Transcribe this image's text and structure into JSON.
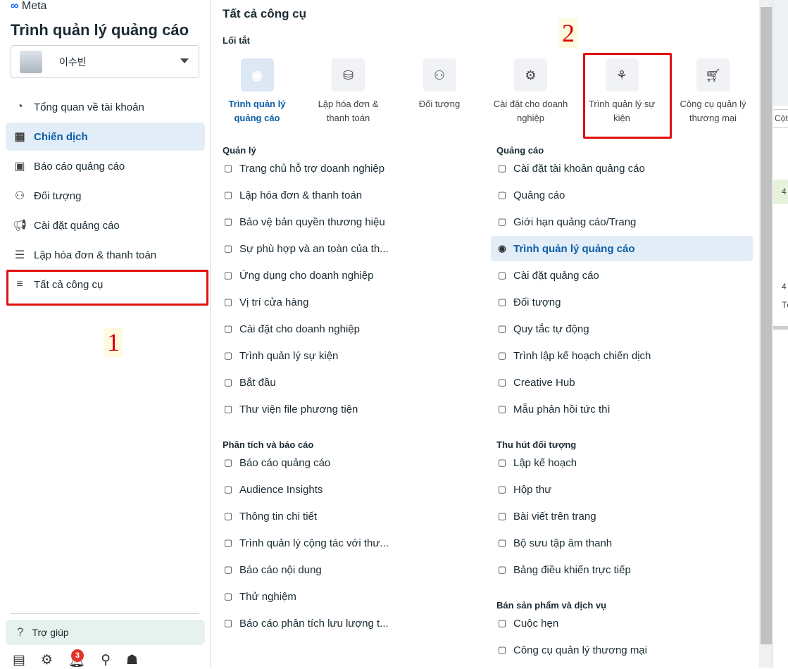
{
  "sidebar": {
    "brand": "Meta",
    "title": "Trình quản lý quảng cáo",
    "account": "이수빈",
    "items": [
      {
        "label": "Tổng quan về tài khoản",
        "icon": "gauge-icon"
      },
      {
        "label": "Chiến dịch",
        "icon": "table-icon",
        "active": true
      },
      {
        "label": "Báo cáo quảng cáo",
        "icon": "report-icon"
      },
      {
        "label": "Đối tượng",
        "icon": "people-icon"
      },
      {
        "label": "Cài đặt quảng cáo",
        "icon": "megaphone-icon"
      },
      {
        "label": "Lập hóa đơn & thanh toán",
        "icon": "billing-icon"
      },
      {
        "label": "Tất cả công cụ",
        "icon": "menu-icon"
      }
    ],
    "help": "Trợ giúp",
    "notification_count": "3"
  },
  "annotations": {
    "one": "1",
    "two": "2",
    "highlight_color": "#e01010"
  },
  "main": {
    "title": "Tất cả công cụ",
    "shortcuts_heading": "Lối tắt",
    "shortcuts": [
      {
        "label": "Trình quản lý quảng cáo",
        "active": true
      },
      {
        "label": "Lập hóa đơn & thanh toán"
      },
      {
        "label": "Đối tượng"
      },
      {
        "label": "Cài đặt cho doanh nghiệp"
      },
      {
        "label": "Trình quản lý sự kiện"
      },
      {
        "label": "Công cụ quản lý thương mại"
      }
    ],
    "manage": {
      "heading": "Quản lý",
      "items": [
        "Trang chủ hỗ trợ doanh nghiệp",
        "Lập hóa đơn & thanh toán",
        "Bảo vệ bản quyền thương hiệu",
        "Sự phù hợp và an toàn của th...",
        "Ứng dụng cho doanh nghiệp",
        "Vị trí cửa hàng",
        "Cài đặt cho doanh nghiệp",
        "Trình quản lý sự kiện",
        "Bắt đầu",
        "Thư viện file phương tiện"
      ]
    },
    "analytics": {
      "heading": "Phân tích và báo cáo",
      "items": [
        "Báo cáo quảng cáo",
        "Audience Insights",
        "Thông tin chi tiết",
        "Trình quản lý cộng tác với thư...",
        "Báo cáo nội dung",
        "Thử nghiệm",
        "Báo cáo phân tích lưu lượng t..."
      ]
    },
    "ads": {
      "heading": "Quảng cáo",
      "items": [
        "Cài đặt tài khoản quảng cáo",
        "Quảng cáo",
        "Giới hạn quảng cáo/Trang",
        "Trình quản lý quảng cáo",
        "Cài đặt quảng cáo",
        "Đối tượng",
        "Quy tắc tự động",
        "Trình lập kế hoạch chiến dịch",
        "Creative Hub",
        "Mẫu phản hồi tức thì"
      ]
    },
    "engage": {
      "heading": "Thu hút đối tượng",
      "items": [
        "Lập kế hoạch",
        "Hộp thư",
        "Bài viết trên trang",
        "Bộ sưu tập âm thanh",
        "Bảng điều khiển trực tiếp"
      ]
    },
    "sell": {
      "heading": "Bán sản phẩm và dịch vụ",
      "items": [
        "Cuộc hẹn",
        "Công cụ quản lý thương mại"
      ]
    }
  },
  "background": {
    "col": "Cột",
    "val1": "4",
    "val2": "4",
    "val3": "Tổ"
  }
}
